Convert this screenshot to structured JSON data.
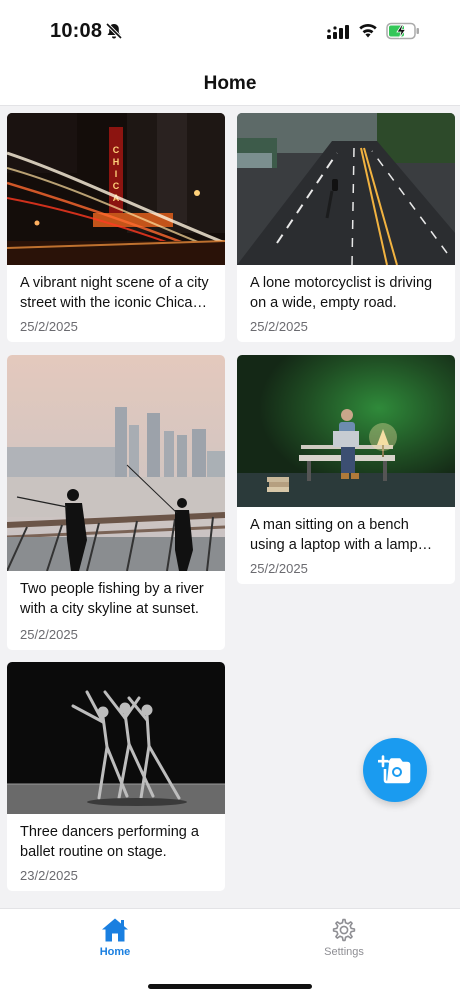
{
  "status_bar": {
    "time": "10:08"
  },
  "header": {
    "title": "Home"
  },
  "posts": [
    {
      "description": "A vibrant night scene of a city street with the iconic Chicago theatre sign.",
      "date": "25/2/2025"
    },
    {
      "description": "A lone motorcyclist is driving on a wide, empty road.",
      "date": "25/2/2025"
    },
    {
      "description": "Two people fishing by a river with a city skyline at sunset.",
      "date": "25/2/2025"
    },
    {
      "description": "A man sitting on a bench using a laptop with a lamp and books.",
      "date": "25/2/2025"
    },
    {
      "description": "Three dancers performing a ballet routine on stage.",
      "date": "23/2/2025"
    }
  ],
  "fab": {
    "icon": "add-photo-icon"
  },
  "tabs": [
    {
      "label": "Home",
      "icon": "home-icon",
      "active": true
    },
    {
      "label": "Settings",
      "icon": "gear-icon",
      "active": false
    }
  ],
  "colors": {
    "accent": "#1a9bf0",
    "tab_active": "#1a7fe0",
    "tab_inactive": "#8e8e93"
  }
}
